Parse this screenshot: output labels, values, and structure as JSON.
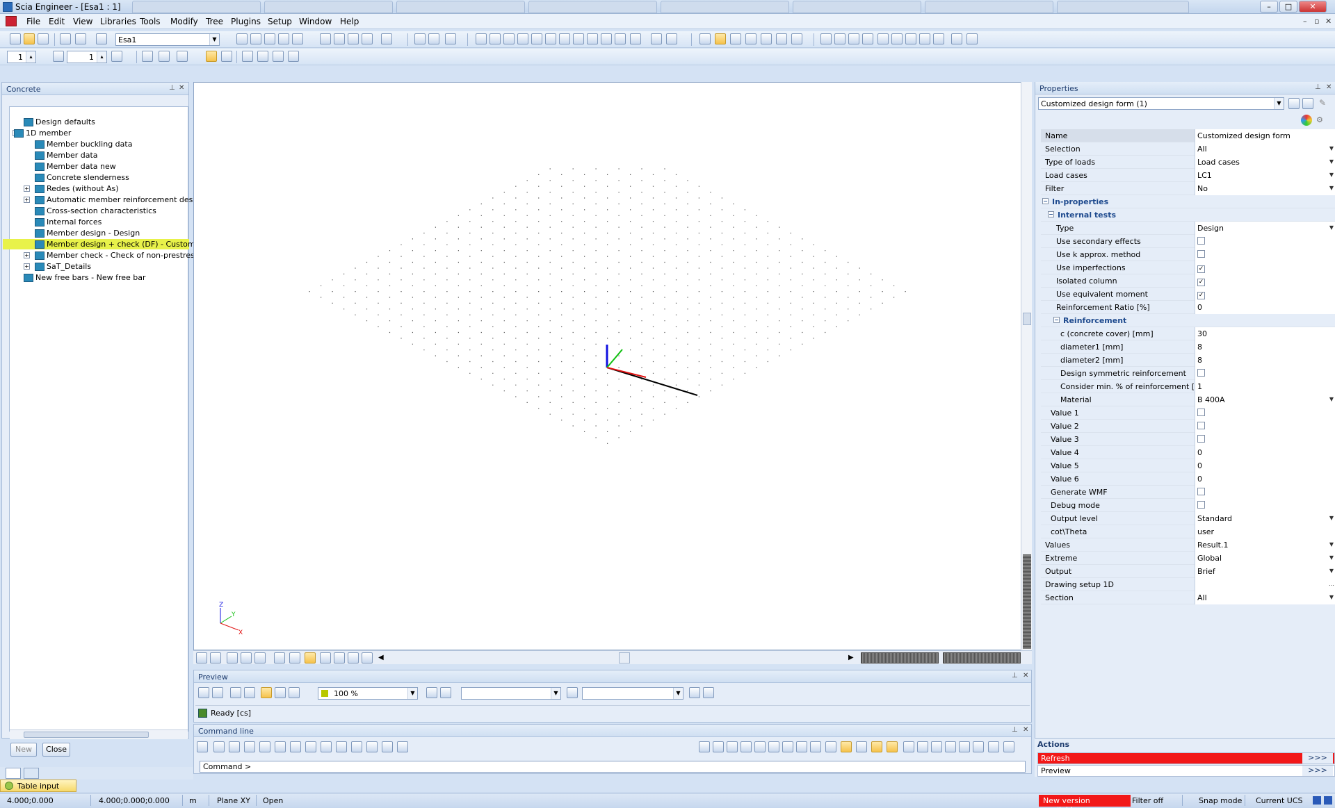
{
  "window": {
    "title": "Scia Engineer - [Esa1 : 1]",
    "controls": {
      "minimize": "–",
      "maximize": "□",
      "close": "✕"
    }
  },
  "menu": {
    "items": [
      "File",
      "Edit",
      "View",
      "Libraries",
      "Tools",
      "Modify",
      "Tree",
      "Plugins",
      "Setup",
      "Window",
      "Help"
    ]
  },
  "toolbar": {
    "project_combo": "Esa1",
    "spin1": "1",
    "spin2": "1"
  },
  "left_panel": {
    "title": "Concrete",
    "tree": [
      {
        "label": "Design defaults",
        "level": 1,
        "toggle": ""
      },
      {
        "label": "1D member",
        "level": 0,
        "toggle": "−"
      },
      {
        "label": "Member buckling data",
        "level": 2,
        "toggle": ""
      },
      {
        "label": "Member data",
        "level": 2,
        "toggle": ""
      },
      {
        "label": "Member data new",
        "level": 2,
        "toggle": ""
      },
      {
        "label": "Concrete slenderness",
        "level": 2,
        "toggle": ""
      },
      {
        "label": "Redes (without As)",
        "level": 2,
        "toggle": "+"
      },
      {
        "label": "Automatic member reinforcement design",
        "level": 2,
        "toggle": "+"
      },
      {
        "label": "Cross-section characteristics",
        "level": 2,
        "toggle": ""
      },
      {
        "label": "Internal forces",
        "level": 2,
        "toggle": ""
      },
      {
        "label": "Member design - Design",
        "level": 2,
        "toggle": ""
      },
      {
        "label": "Member design + check (DF) - Customize",
        "level": 2,
        "toggle": "",
        "selected": true
      },
      {
        "label": "Member check - Check of non-prestresse",
        "level": 2,
        "toggle": "+"
      },
      {
        "label": "SaT_Details",
        "level": 2,
        "toggle": "+"
      },
      {
        "label": "New free bars - New free bar",
        "level": 1,
        "toggle": ""
      }
    ],
    "new_button": "New",
    "close_button": "Close"
  },
  "canvas": {
    "axes": {
      "x": "X",
      "y": "Y",
      "z": "Z"
    }
  },
  "preview": {
    "title": "Preview",
    "zoom": "100 %",
    "status": "Ready [cs]"
  },
  "command_line": {
    "title": "Command line",
    "prompt": "Command >"
  },
  "properties": {
    "title": "Properties",
    "selector": "Customized design form (1)",
    "rows": [
      {
        "key": "Name",
        "value": "Customized design form",
        "indent": 0,
        "type": "header"
      },
      {
        "key": "Selection",
        "value": "All",
        "indent": 0,
        "type": "dropdown"
      },
      {
        "key": "Type of loads",
        "value": "Load cases",
        "indent": 0,
        "type": "dropdown"
      },
      {
        "key": "Load cases",
        "value": "LC1",
        "indent": 0,
        "type": "dropdown"
      },
      {
        "key": "Filter",
        "value": "No",
        "indent": 0,
        "type": "dropdown"
      },
      {
        "key": "In-properties",
        "value": "",
        "indent": 0,
        "type": "group"
      },
      {
        "key": "Internal tests",
        "value": "",
        "indent": 1,
        "type": "group"
      },
      {
        "key": "Type",
        "value": "Design",
        "indent": 2,
        "type": "dropdown"
      },
      {
        "key": "Use secondary effects",
        "value": "",
        "indent": 2,
        "type": "checkbox",
        "checked": false
      },
      {
        "key": "Use k approx. method",
        "value": "",
        "indent": 2,
        "type": "checkbox",
        "checked": false
      },
      {
        "key": "Use imperfections",
        "value": "",
        "indent": 2,
        "type": "checkbox",
        "checked": true
      },
      {
        "key": "Isolated column",
        "value": "",
        "indent": 2,
        "type": "checkbox",
        "checked": true
      },
      {
        "key": "Use equivalent moment",
        "value": "",
        "indent": 2,
        "type": "checkbox",
        "checked": true
      },
      {
        "key": "Reinforcement Ratio [%]",
        "value": "0",
        "indent": 2,
        "type": "text"
      },
      {
        "key": "Reinforcement",
        "value": "",
        "indent": 2,
        "type": "group"
      },
      {
        "key": "c (concrete cover) [mm]",
        "value": "30",
        "indent": 3,
        "type": "text"
      },
      {
        "key": "diameter1 [mm]",
        "value": "8",
        "indent": 3,
        "type": "text"
      },
      {
        "key": "diameter2 [mm]",
        "value": "8",
        "indent": 3,
        "type": "text"
      },
      {
        "key": "Design symmetric reinforcement",
        "value": "",
        "indent": 3,
        "type": "checkbox",
        "checked": false
      },
      {
        "key": "Consider min. % of reinforcement [%]",
        "value": "1",
        "indent": 3,
        "type": "text"
      },
      {
        "key": "Material",
        "value": "B 400A",
        "indent": 3,
        "type": "dropdown"
      },
      {
        "key": "Value 1",
        "value": "",
        "indent": 1,
        "type": "checkbox",
        "checked": false
      },
      {
        "key": "Value 2",
        "value": "",
        "indent": 1,
        "type": "checkbox",
        "checked": false
      },
      {
        "key": "Value 3",
        "value": "",
        "indent": 1,
        "type": "checkbox",
        "checked": false
      },
      {
        "key": "Value 4",
        "value": "0",
        "indent": 1,
        "type": "text"
      },
      {
        "key": "Value 5",
        "value": "0",
        "indent": 1,
        "type": "text"
      },
      {
        "key": "Value 6",
        "value": "0",
        "indent": 1,
        "type": "text"
      },
      {
        "key": "Generate WMF",
        "value": "",
        "indent": 1,
        "type": "checkbox",
        "checked": false
      },
      {
        "key": "Debug mode",
        "value": "",
        "indent": 1,
        "type": "checkbox",
        "checked": false
      },
      {
        "key": "Output level",
        "value": "Standard",
        "indent": 1,
        "type": "dropdown"
      },
      {
        "key": "cot\\Theta",
        "value": "user",
        "indent": 1,
        "type": "text"
      },
      {
        "key": "Values",
        "value": "Result.1",
        "indent": 0,
        "type": "dropdown"
      },
      {
        "key": "Extreme",
        "value": "Global",
        "indent": 0,
        "type": "dropdown"
      },
      {
        "key": "Output",
        "value": "Brief",
        "indent": 0,
        "type": "dropdown"
      },
      {
        "key": "Drawing setup 1D",
        "value": "",
        "indent": 0,
        "type": "ellipsis"
      },
      {
        "key": "Section",
        "value": "All",
        "indent": 0,
        "type": "dropdown"
      }
    ]
  },
  "actions": {
    "title": "Actions",
    "refresh": "Refresh",
    "preview": "Preview",
    "go": ">>>"
  },
  "bottom": {
    "table_input": "Table input"
  },
  "status": {
    "coord1": "4.000;0.000",
    "coord2": "4.000;0.000;0.000",
    "units": "m",
    "plane": "Plane XY",
    "mode": "Open",
    "new_version": "New version available",
    "filter": "Filter off",
    "snap": "Snap mode",
    "ucs": "Current UCS"
  },
  "colors": {
    "refresh_bg": "#f21818",
    "selected_tree": "#e8f24a",
    "axis_x": "#e01010",
    "axis_y": "#10c010",
    "axis_z": "#1010e0"
  }
}
